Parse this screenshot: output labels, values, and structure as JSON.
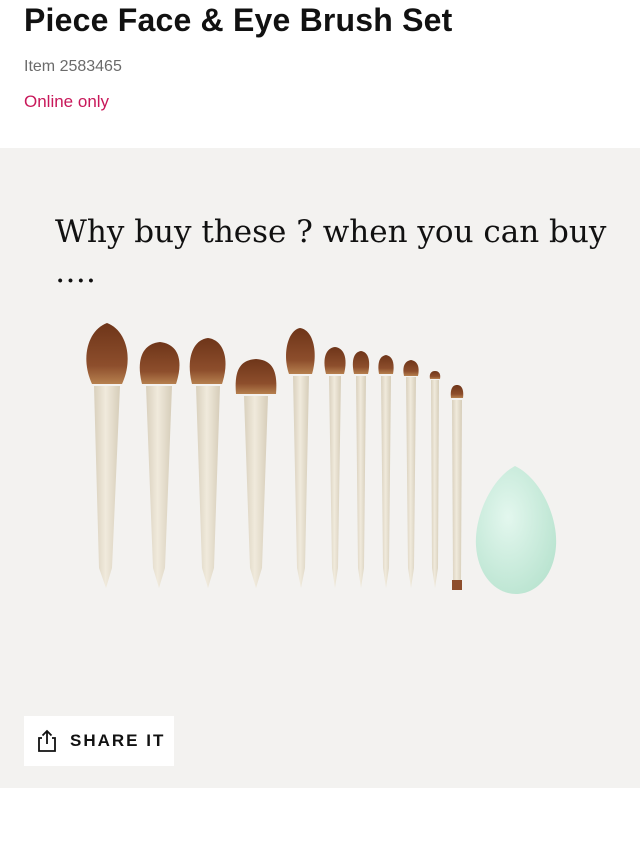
{
  "product": {
    "title": "Piece Face & Eye Brush Set",
    "item_number": "Item 2583465",
    "availability": "Online only"
  },
  "hero": {
    "caption": "Why buy these ? when you can buy …."
  },
  "share": {
    "label": "SHARE IT",
    "icon": "share-icon"
  },
  "colors": {
    "availability": "#c8185a",
    "hero_background": "#f3f2f0",
    "brush_handle": "#e8e0cf",
    "brush_bristle": "#8a4a2b",
    "sponge": "#cfeee0"
  }
}
